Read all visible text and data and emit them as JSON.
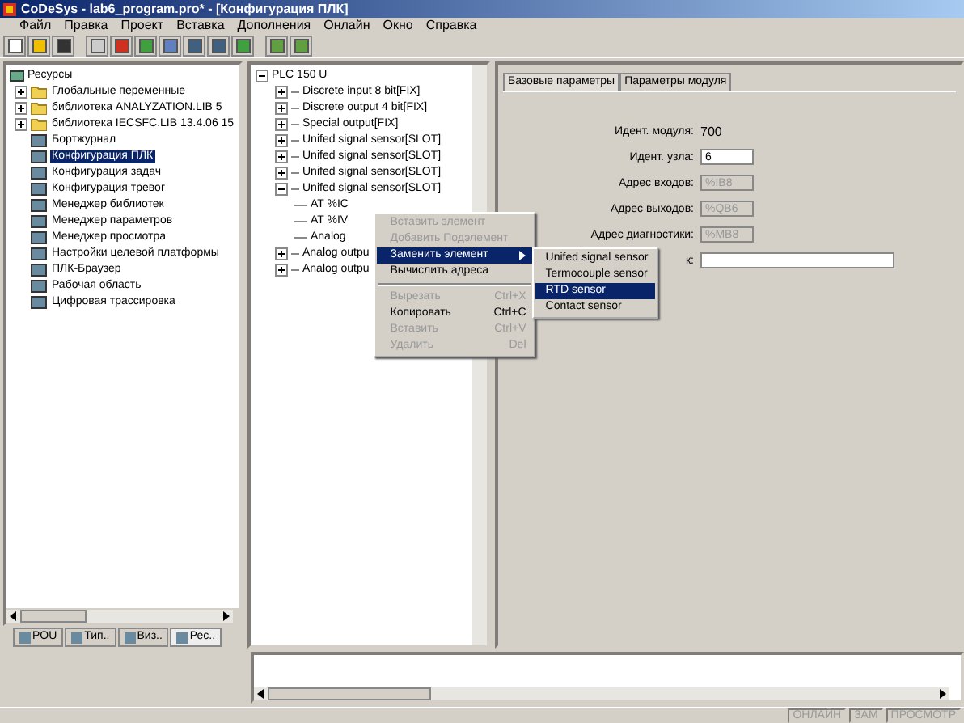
{
  "window": {
    "title": "CoDeSys - lab6_program.pro* - [Конфигурация ПЛК]"
  },
  "menu": [
    "Файл",
    "Правка",
    "Проект",
    "Вставка",
    "Дополнения",
    "Онлайн",
    "Окно",
    "Справка"
  ],
  "resources_tree": {
    "root": "Ресурсы",
    "items": [
      {
        "label": "Глобальные переменные",
        "kind": "folder",
        "expanded": false,
        "selected": false
      },
      {
        "label": "библиотека ANALYZATION.LIB 5",
        "kind": "folder",
        "expanded": false,
        "selected": false
      },
      {
        "label": "библиотека IECSFC.LIB 13.4.06 15",
        "kind": "folder",
        "expanded": false,
        "selected": false
      },
      {
        "label": "Бортжурнал",
        "kind": "resource",
        "selected": false
      },
      {
        "label": "Конфигурация ПЛК",
        "kind": "resource",
        "selected": true
      },
      {
        "label": "Конфигурация задач",
        "kind": "resource",
        "selected": false
      },
      {
        "label": "Конфигурация тревог",
        "kind": "resource",
        "selected": false
      },
      {
        "label": "Менеджер библиотек",
        "kind": "resource",
        "selected": false
      },
      {
        "label": "Менеджер параметров",
        "kind": "resource",
        "selected": false
      },
      {
        "label": "Менеджер просмотра",
        "kind": "resource",
        "selected": false
      },
      {
        "label": "Настройки целевой платформы",
        "kind": "resource",
        "selected": false
      },
      {
        "label": "ПЛК-Браузер",
        "kind": "resource",
        "selected": false
      },
      {
        "label": "Рабочая область",
        "kind": "resource",
        "selected": false
      },
      {
        "label": "Цифровая трассировка",
        "kind": "resource",
        "selected": false
      }
    ]
  },
  "left_tabs": [
    {
      "label": "POU",
      "selected": false
    },
    {
      "label": "Тип..",
      "selected": false
    },
    {
      "label": "Виз..",
      "selected": false
    },
    {
      "label": "Рес..",
      "selected": true
    }
  ],
  "config_tree": {
    "label": "PLC 150 U",
    "expanded": true,
    "children": [
      {
        "label": "Discrete input 8 bit[FIX]",
        "expanded": false
      },
      {
        "label": "Discrete output 4 bit[FIX]",
        "expanded": false
      },
      {
        "label": "Special output[FIX]",
        "expanded": false
      },
      {
        "label": "Unifed signal sensor[SLOT]",
        "expanded": false
      },
      {
        "label": "Unifed signal sensor[SLOT]",
        "expanded": false
      },
      {
        "label": "Unifed signal sensor[SLOT]",
        "expanded": false
      },
      {
        "label": "Unifed signal sensor[SLOT]",
        "expanded": true,
        "children": [
          {
            "label": "AT %IC"
          },
          {
            "label": "AT %IV"
          },
          {
            "label": "Analog"
          }
        ]
      },
      {
        "label": "Analog outpu",
        "expanded": false
      },
      {
        "label": "Analog outpu",
        "expanded": false
      }
    ]
  },
  "tabs": [
    {
      "label": "Базовые параметры",
      "selected": true
    },
    {
      "label": "Параметры модуля",
      "selected": false
    }
  ],
  "fields": [
    {
      "label": "Идент. модуля:",
      "kind": "text",
      "value": "700"
    },
    {
      "label": "Идент. узла:",
      "kind": "input",
      "value": "6",
      "disabled": false
    },
    {
      "label": "Адрес входов:",
      "kind": "input",
      "value": "%IB8",
      "disabled": true
    },
    {
      "label": "Адрес выходов:",
      "kind": "input",
      "value": "%QB6",
      "disabled": true
    },
    {
      "label": "Адрес диагностики:",
      "kind": "input",
      "value": "%MB8",
      "disabled": true
    },
    {
      "label": "к:",
      "kind": "input",
      "disabled": false
    }
  ],
  "context_menu": [
    {
      "kind": "item",
      "label": "Вставить элемент",
      "disabled": true,
      "selected": false
    },
    {
      "kind": "item",
      "label": "Добавить Подэлемент",
      "disabled": true,
      "selected": false
    },
    {
      "kind": "submenu",
      "label": "Заменить элемент",
      "disabled": false,
      "selected": true
    },
    {
      "kind": "item",
      "label": "Вычислить адреса",
      "disabled": false,
      "selected": false
    },
    {
      "kind": "separator"
    },
    {
      "kind": "item",
      "label": "Вырезать",
      "shortcut": "Ctrl+X",
      "disabled": true,
      "selected": false
    },
    {
      "kind": "item",
      "label": "Копировать",
      "shortcut": "Ctrl+C",
      "disabled": false,
      "selected": false
    },
    {
      "kind": "item",
      "label": "Вставить",
      "shortcut": "Ctrl+V",
      "disabled": true,
      "selected": false
    },
    {
      "kind": "item",
      "label": "Удалить",
      "shortcut": "Del",
      "disabled": true,
      "selected": false
    }
  ],
  "submenu": [
    {
      "label": "Unifed signal sensor",
      "selected": false
    },
    {
      "label": "Termocouple sensor",
      "selected": false
    },
    {
      "label": "RTD sensor",
      "selected": true
    },
    {
      "label": "Contact sensor",
      "selected": false
    }
  ],
  "status_bar": [
    {
      "label": "ОНЛАЙН",
      "disabled": true
    },
    {
      "label": "ЗАМ",
      "disabled": true
    },
    {
      "label": "ПРОСМОТР",
      "disabled": true
    }
  ]
}
